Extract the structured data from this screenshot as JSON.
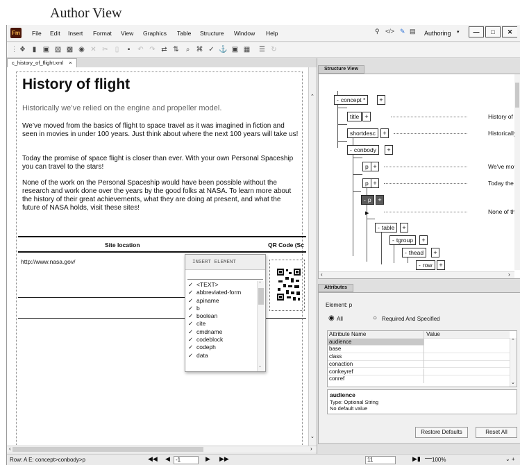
{
  "caption": "Author View",
  "app": {
    "logo": "Fm",
    "menus": [
      "File",
      "Edit",
      "Insert",
      "Format",
      "View",
      "Graphics",
      "Table",
      "Structure",
      "Window",
      "Help"
    ],
    "mode": "Authoring"
  },
  "tab": {
    "label": "c_history_of_flight.xml",
    "close": "×"
  },
  "doc": {
    "title": "History of flight",
    "shortdesc": "Historically we’ve relied on the engine and propeller model.",
    "p1": "We’ve moved from the basics of flight to space travel as it was imagined in fiction and seen in movies in under 100 years. Just think about where the next 100 years will take us!",
    "p2": "Today the promise of space flight is closer than ever. With your own Personal Spaceship you can travel to the stars!",
    "p3": "None of the work on the Personal Spaceship would have been possible without the research and work done over the years by the good folks at NASA. To learn more about the history of their great achievements, what they are doing at present, and what the future of NASA holds, visit these sites!",
    "table": {
      "col1": "Site location",
      "col2": "QR Code (Sc",
      "url": "http://www.nasa.gov/"
    }
  },
  "insert_element": {
    "title": "INSERT ELEMENT",
    "items": [
      "<TEXT>",
      "abbreviated-form",
      "apiname",
      "b",
      "boolean",
      "cite",
      "cmdname",
      "codeblock",
      "codeph",
      "data"
    ]
  },
  "structure_view": {
    "tab": "Structure View",
    "nodes": {
      "concept": "concept *",
      "title": "title",
      "shortdesc": "shortdesc",
      "conbody": "conbody",
      "p": "p",
      "table": "table",
      "tgroup": "tgroup",
      "thead": "thead",
      "row": "row"
    },
    "values": {
      "title": "History of f",
      "shortdesc": "Historically",
      "p1": "We've mov",
      "p2": "Today the",
      "p3": "None of th"
    }
  },
  "attributes": {
    "tab": "Attributes",
    "element": "Element: p",
    "radio_all": "All",
    "radio_req": "Required And Specified",
    "col_name": "Attribute Name",
    "col_value": "Value",
    "rows": [
      "audience",
      "base",
      "class",
      "conaction",
      "conkeyref",
      "conref"
    ],
    "info_name": "audience",
    "info_type": "Type: Optional String",
    "info_default": "No default value",
    "restore": "Restore Defaults",
    "reset": "Reset All"
  },
  "status": {
    "path": "Row: A E: concept>conbody>p",
    "page": "-1",
    "page_field": "11",
    "zoom": "100%"
  }
}
